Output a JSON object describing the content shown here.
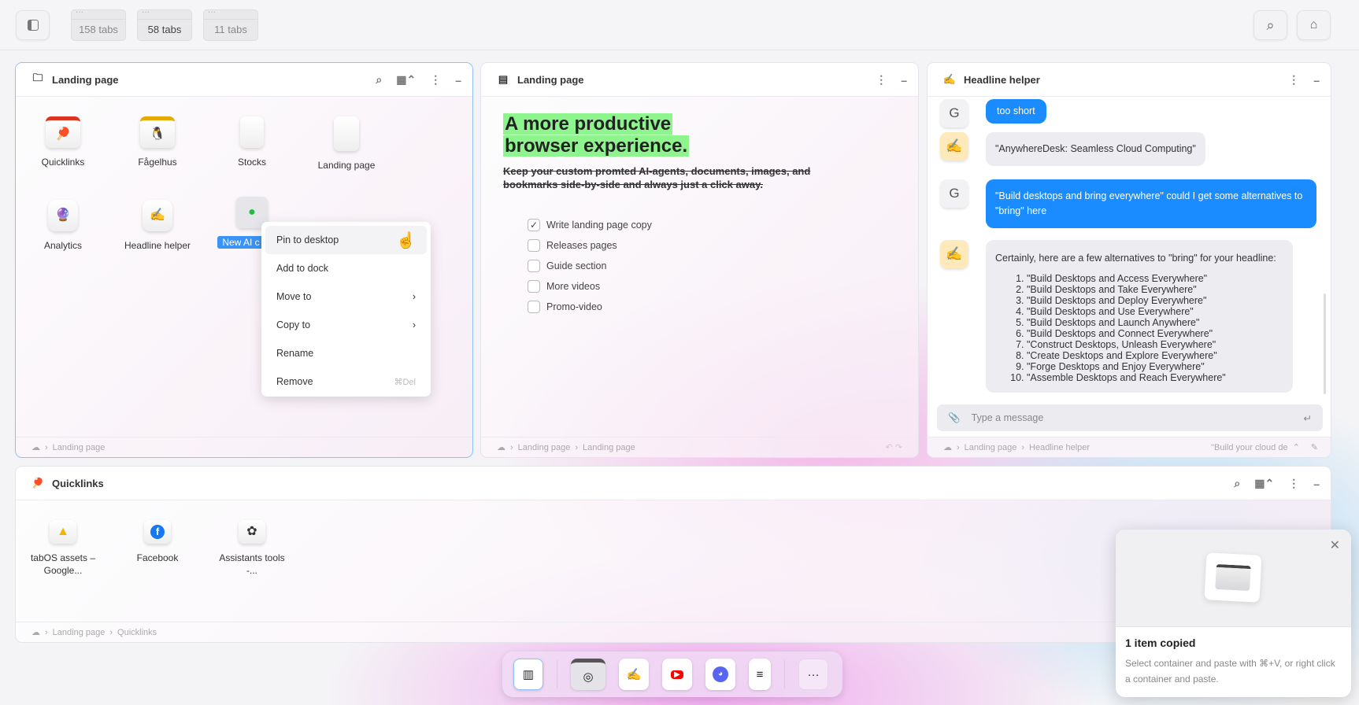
{
  "topbar": {
    "tabs": [
      "158 tabs",
      "58 tabs",
      "11 tabs"
    ]
  },
  "panel1": {
    "title": "Landing page",
    "items": [
      {
        "label": "Quicklinks",
        "icon": "ping-pong-folder-icon"
      },
      {
        "label": "Fågelhus",
        "icon": "penguin-folder-icon"
      },
      {
        "label": "Stocks",
        "icon": "document-icon"
      },
      {
        "label": "Landing page",
        "icon": "document-icon"
      },
      {
        "label": "Analytics",
        "icon": "crystal-ball-chat-icon"
      },
      {
        "label": "Headline helper",
        "icon": "writing-hand-chat-icon"
      },
      {
        "label": "New AI c",
        "icon": "green-chat-icon"
      }
    ],
    "breadcrumb": [
      "Landing page"
    ]
  },
  "context_menu": [
    {
      "label": "Pin to desktop"
    },
    {
      "label": "Add to dock"
    },
    {
      "label": "Move to",
      "submenu": true
    },
    {
      "label": "Copy to",
      "submenu": true
    },
    {
      "label": "Rename"
    },
    {
      "label": "Remove",
      "shortcut": "⌘Del"
    }
  ],
  "panel2": {
    "title": "Landing page",
    "heading_line1": "A more productive",
    "heading_line2": "browser experience.",
    "subtext": "Keep your custom promted AI-agents, documents, images, and bookmarks side-by-side and always just a click away.",
    "checklist": [
      {
        "label": "Write landing page copy",
        "checked": true
      },
      {
        "label": "Releases pages",
        "checked": false
      },
      {
        "label": "Guide section",
        "checked": false
      },
      {
        "label": "More videos",
        "checked": false
      },
      {
        "label": "Promo-video",
        "checked": false
      }
    ],
    "breadcrumb": [
      "Landing page",
      "Landing page"
    ]
  },
  "panel3": {
    "title": "Headline helper",
    "user_initial": "G",
    "messages": {
      "m0": "too short",
      "m1": "\"AnywhereDesk: Seamless Cloud Computing\"",
      "m2": "\"Build desktops and bring everywhere\" could I get some alternatives to \"bring\" here",
      "m3_intro": "Certainly, here are a few alternatives to \"bring\" for your headline:"
    },
    "alternatives": [
      "\"Build Desktops and Access Everywhere\"",
      "\"Build Desktops and Take Everywhere\"",
      "\"Build Desktops and Deploy Everywhere\"",
      "\"Build Desktops and Use Everywhere\"",
      "\"Build Desktops and Launch Anywhere\"",
      "\"Build Desktops and Connect Everywhere\"",
      "\"Construct Desktops, Unleash Everywhere\"",
      "\"Create Desktops and Explore Everywhere\"",
      "\"Forge Desktops and Enjoy Everywhere\"",
      "\"Assemble Desktops and Reach Everywhere\""
    ],
    "input_placeholder": "Type a message",
    "breadcrumb": [
      "Landing page",
      "Headline helper"
    ],
    "prompt_select": "\"Build your cloud de"
  },
  "panel4": {
    "title": "Quicklinks",
    "items": [
      {
        "label": "tabOS assets – Google...",
        "icon": "google-drive-icon"
      },
      {
        "label": "Facebook",
        "icon": "facebook-icon"
      },
      {
        "label": "Assistants tools -...",
        "icon": "openai-icon"
      }
    ],
    "breadcrumb": [
      "Landing page",
      "Quicklinks"
    ]
  },
  "toast": {
    "title": "1 item copied",
    "body": "Select container and paste with ⌘+V, or right click a container and paste."
  },
  "colors": {
    "accent": "#1a8cff",
    "selection_border": "#8ec2f7",
    "highlight": "#8ef58e"
  }
}
